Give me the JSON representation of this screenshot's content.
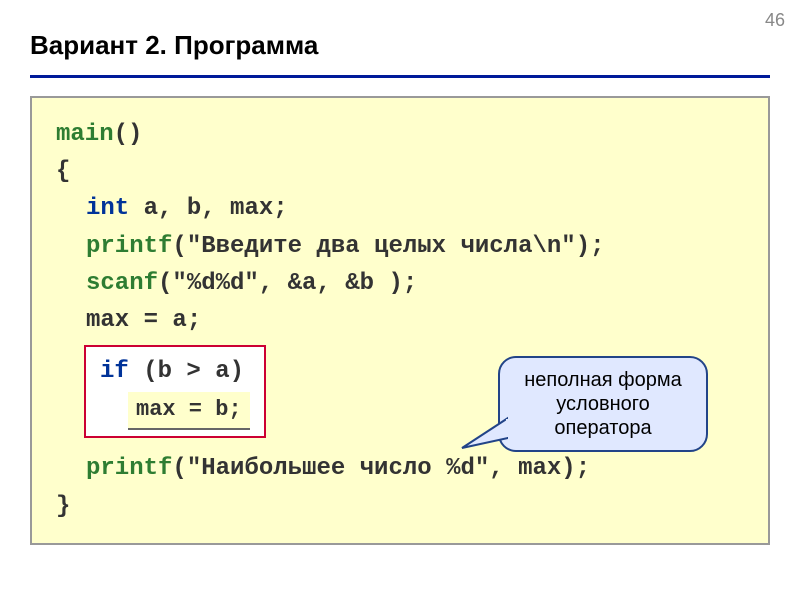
{
  "page_number": "46",
  "title": "Вариант 2. Программа",
  "code": {
    "line1_main": "main",
    "line1_rest": "()",
    "line2": "{",
    "line3_type": "int",
    "line3_rest": " a, b, max;",
    "line4_fn": "printf",
    "line4_args": "(\"Введите два целых числа\\n\");",
    "line5_fn": "scanf",
    "line5_args": "(\"%d%d\", &a, &b );",
    "line6": "max = a;",
    "box_if": "if",
    "box_cond": " (b > a)",
    "box_inner": "max = b;",
    "line7_fn": "printf",
    "line7_args": "(\"Наибольшее число %d\", max);",
    "line8": "}"
  },
  "callout": {
    "line1": "неполная форма",
    "line2": "условного",
    "line3": "оператора"
  }
}
